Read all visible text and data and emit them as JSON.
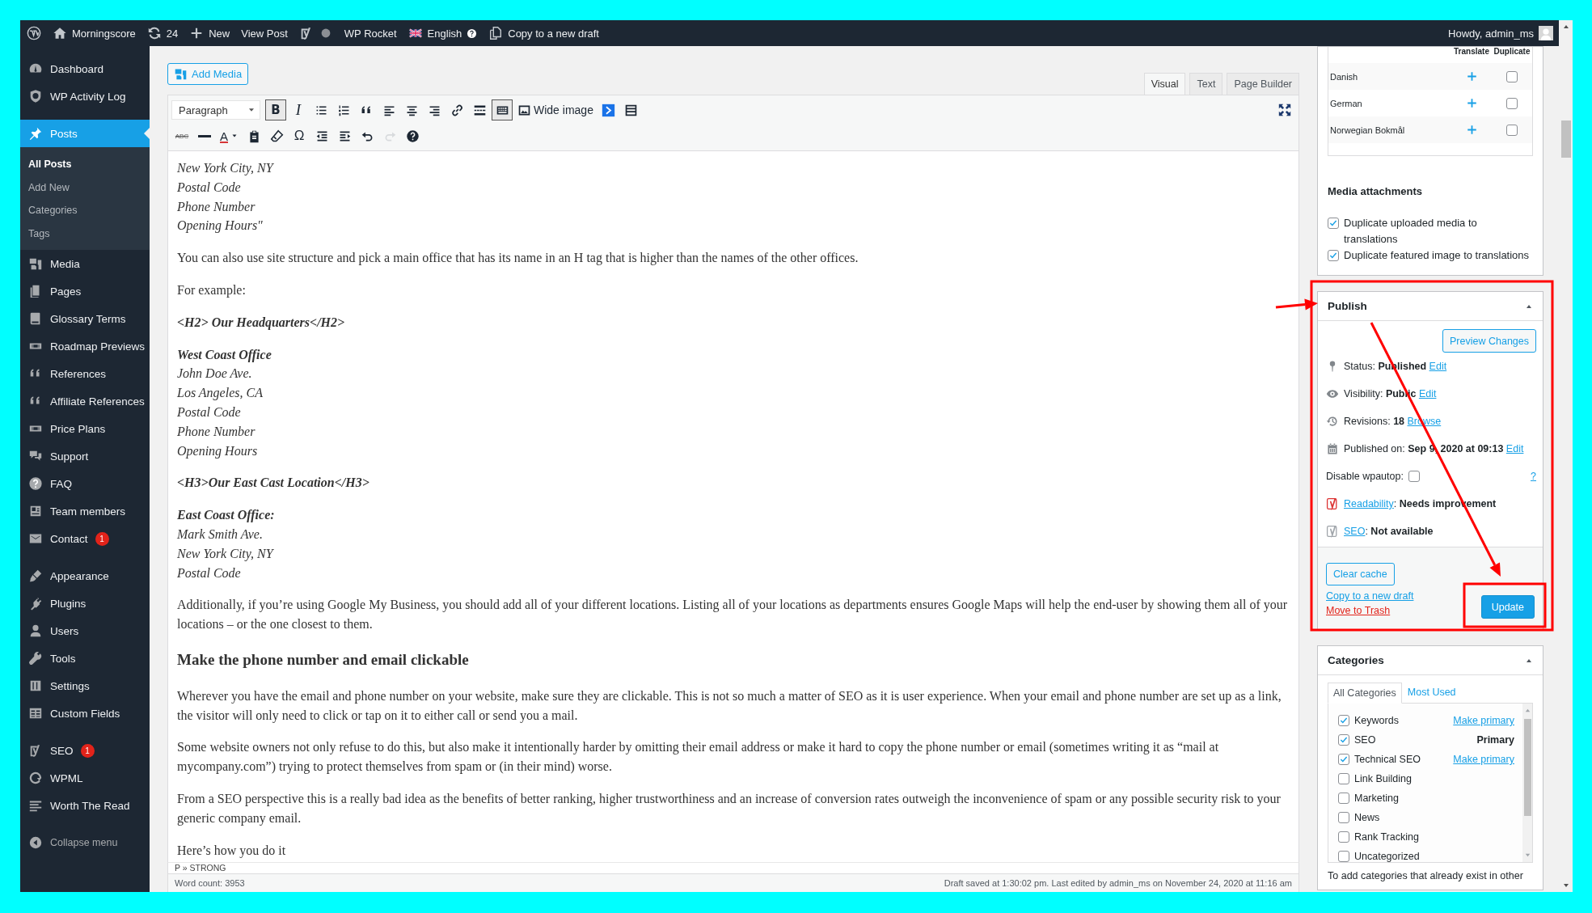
{
  "admin_bar": {
    "site": "Morningscore",
    "updates": "24",
    "new": "New",
    "view_post": "View Post",
    "rocket": "WP Rocket",
    "language": "English",
    "copy_draft": "Copy to a new draft",
    "howdy": "Howdy, admin_ms"
  },
  "sidebar": {
    "groups": [
      [
        {
          "kind": "gauge",
          "label": "Dashboard",
          "selected": false
        },
        {
          "kind": "shield",
          "label": "WP Activity Log",
          "selected": false
        }
      ],
      [
        {
          "kind": "pin",
          "label": "Posts",
          "selected": true,
          "children": [
            {
              "label": "All Posts",
              "selected": true
            },
            {
              "label": "Add New",
              "selected": false
            },
            {
              "label": "Categories",
              "selected": false
            },
            {
              "label": "Tags",
              "selected": false
            }
          ]
        },
        {
          "kind": "media",
          "label": "Media",
          "selected": false
        },
        {
          "kind": "pages",
          "label": "Pages",
          "selected": false
        },
        {
          "kind": "book",
          "label": "Glossary Terms",
          "selected": false
        },
        {
          "kind": "ticket",
          "label": "Roadmap Previews",
          "selected": false
        },
        {
          "kind": "quote",
          "label": "References",
          "selected": false
        },
        {
          "kind": "quote",
          "label": "Affiliate References",
          "selected": false
        },
        {
          "kind": "ticket",
          "label": "Price Plans",
          "selected": false
        },
        {
          "kind": "comments",
          "label": "Support",
          "selected": false
        },
        {
          "kind": "help",
          "label": "FAQ",
          "selected": false
        },
        {
          "kind": "idcard",
          "label": "Team members",
          "selected": false
        },
        {
          "kind": "mail",
          "label": "Contact",
          "selected": false,
          "badge": "1"
        }
      ],
      [
        {
          "kind": "brush",
          "label": "Appearance",
          "selected": false
        },
        {
          "kind": "plug",
          "label": "Plugins",
          "selected": false
        },
        {
          "kind": "user",
          "label": "Users",
          "selected": false
        },
        {
          "kind": "wrench",
          "label": "Tools",
          "selected": false
        },
        {
          "kind": "sliders",
          "label": "Settings",
          "selected": false
        },
        {
          "kind": "table",
          "label": "Custom Fields",
          "selected": false
        }
      ],
      [
        {
          "kind": "yoast",
          "label": "SEO",
          "selected": false,
          "badge": "1"
        },
        {
          "kind": "wpml",
          "label": "WPML",
          "selected": false
        },
        {
          "kind": "lines",
          "label": "Worth The Read",
          "selected": false
        }
      ]
    ],
    "collapse": "Collapse menu"
  },
  "editor": {
    "add_media": "Add Media",
    "tabs": [
      {
        "label": "Visual",
        "selected": true
      },
      {
        "label": "Text",
        "selected": false
      },
      {
        "label": "Page Builder",
        "selected": false
      }
    ],
    "format": "Paragraph",
    "toolbar_rows": [
      [
        {
          "kind": "bold",
          "label": "B",
          "pressed": true,
          "disabled": false
        },
        {
          "kind": "italic",
          "label": "I",
          "pressed": false,
          "disabled": false
        },
        {
          "kind": "ul",
          "pressed": false,
          "disabled": false
        },
        {
          "kind": "ol",
          "pressed": false,
          "disabled": false
        },
        {
          "kind": "blockquote",
          "pressed": false,
          "disabled": false
        },
        {
          "kind": "alignl",
          "pressed": false,
          "disabled": false
        },
        {
          "kind": "alignc",
          "pressed": false,
          "disabled": false
        },
        {
          "kind": "alignr",
          "pressed": false,
          "disabled": false
        },
        {
          "kind": "link",
          "pressed": false,
          "disabled": false
        },
        {
          "kind": "more",
          "pressed": false,
          "disabled": false
        },
        {
          "kind": "kitchen",
          "pressed": true,
          "disabled": false
        },
        {
          "kind": "image",
          "label": "Wide image",
          "pressed": false,
          "disabled": false
        },
        {
          "kind": "arrowbox",
          "pressed": false,
          "disabled": false
        },
        {
          "kind": "listtable",
          "pressed": false,
          "disabled": false
        }
      ],
      [
        {
          "kind": "strike",
          "label": "ABC",
          "pressed": false,
          "disabled": false
        },
        {
          "kind": "hr",
          "pressed": false,
          "disabled": false
        },
        {
          "kind": "textcolor",
          "label": "A",
          "pressed": false,
          "disabled": false
        },
        {
          "kind": "paste",
          "pressed": false,
          "disabled": false
        },
        {
          "kind": "eraser",
          "pressed": false,
          "disabled": false
        },
        {
          "kind": "omega",
          "label": "Ω",
          "pressed": false,
          "disabled": false
        },
        {
          "kind": "outdent",
          "pressed": false,
          "disabled": false
        },
        {
          "kind": "indent",
          "pressed": false,
          "disabled": false
        },
        {
          "kind": "undo",
          "pressed": false,
          "disabled": false
        },
        {
          "kind": "redo",
          "pressed": false,
          "disabled": true
        },
        {
          "kind": "help",
          "pressed": false,
          "disabled": false
        }
      ]
    ],
    "content": [
      {
        "kind": "lines",
        "lines": [
          "New York City, NY",
          "Postal Code",
          "Phone Number",
          "Opening Hours\""
        ]
      },
      {
        "kind": "paragraph",
        "text": "You can also use site structure and pick a main office that has its name in an H tag that is higher than the names of the other offices."
      },
      {
        "kind": "paragraph",
        "text": "For example:"
      },
      {
        "kind": "code",
        "text": "<H2> Our Headquarters</H2>"
      },
      {
        "kind": "lines",
        "title": "West Coast Office",
        "lines": [
          "John Doe Ave.",
          "Los Angeles, CA",
          "Postal Code",
          "Phone Number",
          "Opening Hours"
        ]
      },
      {
        "kind": "code",
        "text": "<H3>Our East Cast Location</H3>"
      },
      {
        "kind": "lines",
        "title": "East Coast Office:",
        "lines": [
          "Mark Smith Ave.",
          "New York City, NY",
          "Postal Code"
        ]
      },
      {
        "kind": "paragraph",
        "text": "Additionally, if you’re using Google My Business, you should add all of your different locations. Listing all of your locations as departments ensures Google Maps will help the end-user by showing them all of your locations – or the one closest to them."
      },
      {
        "kind": "heading",
        "text": "Make the phone number and email clickable"
      },
      {
        "kind": "paragraph",
        "text": "Wherever you have the email and phone number on your website, make sure they are clickable. This is not so much a matter of SEO as it is user experience. When your email and phone number are set up as a link, the visitor will only need to click or tap on it to either call or send you a mail."
      },
      {
        "kind": "paragraph",
        "text": "Some website owners not only refuse to do this, but also make it intentionally harder by omitting their email address or make it hard to copy the phone number or email (sometimes writing it as “mail at mycompany.com”) trying to protect themselves from spam or (in their mind) worse."
      },
      {
        "kind": "paragraph",
        "text": "From a SEO perspective this is a really bad idea as the benefits of better ranking, higher trustworthiness and an increase of conversion rates outweigh the inconvenience of spam or any possible security risk to your generic company email."
      },
      {
        "kind": "paragraph",
        "text": "Here’s how you do it"
      }
    ],
    "path": "P » STRONG",
    "word_count": "Word count: 3953",
    "status": "Draft saved at 1:30:02 pm. Last edited by admin_ms on November 24, 2020 at 11:16 am"
  },
  "translation": {
    "columns": [
      "Translate",
      "Duplicate"
    ],
    "languages": [
      {
        "name": "Danish",
        "duplicate": false
      },
      {
        "name": "German",
        "duplicate": false
      },
      {
        "name": "Norwegian Bokmål",
        "duplicate": false
      }
    ]
  },
  "media_attachments": {
    "title": "Media attachments",
    "options": [
      {
        "label": "Duplicate uploaded media to translations",
        "checked": true
      },
      {
        "label": "Duplicate featured image to translations",
        "checked": true
      }
    ]
  },
  "publish": {
    "title": "Publish",
    "expanded": true,
    "preview": "Preview Changes",
    "rows": [
      {
        "kind": "status",
        "text": "Status: **Published**",
        "link": "Edit"
      },
      {
        "kind": "visibility",
        "text": "Visibility: **Public**",
        "link": "Edit"
      },
      {
        "kind": "revisions",
        "text": "Revisions: **18**",
        "link": "Browse"
      },
      {
        "kind": "date",
        "text": "Published on: **Sep 9, 2020 at 09:13**",
        "link": "Edit"
      }
    ],
    "wpautop": {
      "label": "Disable wpautop:",
      "checked": false,
      "help": "?"
    },
    "yoast": [
      {
        "link": "Readability",
        "rest": ": **Needs improvement**",
        "color": "#dc3232"
      },
      {
        "link": "SEO",
        "rest": ": **Not available**",
        "color": "#a0a5aa"
      }
    ],
    "clear_cache": "Clear cache",
    "copy_draft": "Copy to a new draft",
    "trash": "Move to Trash",
    "update": "Update"
  },
  "categories": {
    "title": "Categories",
    "expanded": true,
    "tabs": [
      {
        "label": "All Categories",
        "selected": true
      },
      {
        "label": "Most Used",
        "selected": false
      }
    ],
    "items": [
      {
        "label": "Keywords",
        "checked": true,
        "action": {
          "kind": "link",
          "text": "Make primary"
        }
      },
      {
        "label": "SEO",
        "checked": true,
        "action": {
          "kind": "label",
          "text": "Primary"
        }
      },
      {
        "label": "Technical SEO",
        "checked": true,
        "action": {
          "kind": "link",
          "text": "Make primary"
        }
      },
      {
        "label": "Link Building",
        "checked": false
      },
      {
        "label": "Marketing",
        "checked": false
      },
      {
        "label": "News",
        "checked": false
      },
      {
        "label": "Rank Tracking",
        "checked": false
      },
      {
        "label": "Uncategorized",
        "checked": false
      }
    ],
    "note": "To add categories that already exist in other"
  }
}
